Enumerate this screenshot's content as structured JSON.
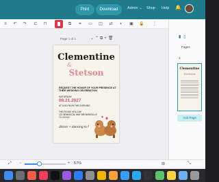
{
  "header": {
    "print_label": "Print",
    "download_label": "Download",
    "nav": [
      "Admin ⌄",
      "Shop",
      "Help"
    ]
  },
  "canvas": {
    "page_label": "Page 1 of 1",
    "invite": {
      "name1": "Clementine",
      "amp": "&",
      "name2": "Stetson",
      "request": "REQUEST THE HONOR OF YOUR PRESENCE AT THEIR WEDDING CELEBRATION",
      "day": "SATURDAY",
      "date": "08.21.2027",
      "time": "AT 6:00 PM IN THE EVENING",
      "venue_lines": [
        "THE PIGGIE HOLLOW",
        "123 WHIMSICAL WAY BROWNSVILLE",
        "TX XXXXX"
      ],
      "dinner": "dinner + dancing to f"
    }
  },
  "right_panel": {
    "title": "Pages",
    "page_number": "1",
    "thumb_name1": "Clementine",
    "thumb_name2": "Stetson",
    "add_page_label": "Add Page"
  },
  "bottom": {
    "zoom_label": "57%",
    "zoom_fraction": 0.57
  },
  "colors": {
    "accent": "#1f7a8c",
    "button": "#2f97aa",
    "delete": "#d9394c",
    "pink": "#d88b95"
  },
  "dock_icons": [
    "finder-icon",
    "apps-icon",
    "calendar-icon",
    "music-icon",
    "tv-icon",
    "podcasts-icon",
    "app-store-icon",
    "settings-icon",
    "chrome-icon",
    "photos-icon",
    "mail-icon",
    "files-icon",
    "terminal-icon",
    "maps-icon",
    "notes-icon",
    "preview-icon",
    "trash-icon"
  ]
}
